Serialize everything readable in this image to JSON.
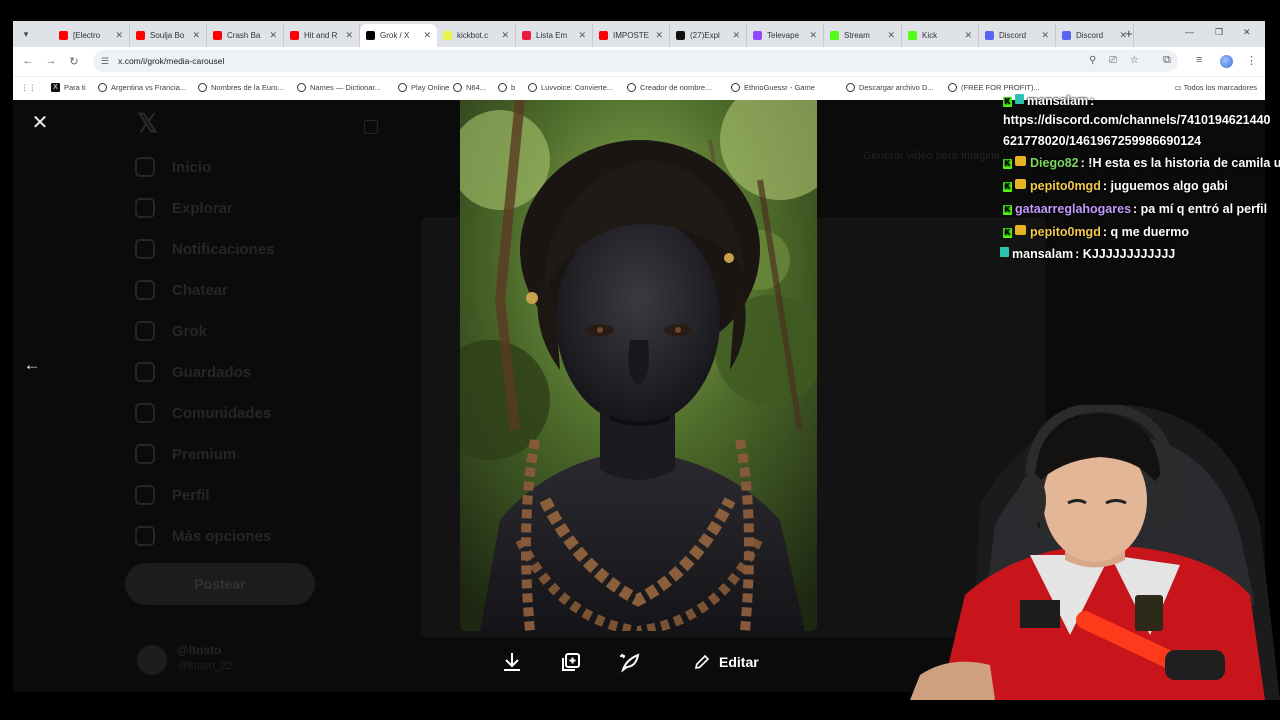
{
  "browser": {
    "tabs": [
      {
        "title": "[Electro",
        "color": "#ff0000"
      },
      {
        "title": "Soulja Bo",
        "color": "#ff0000"
      },
      {
        "title": "Crash Ba",
        "color": "#ff0000"
      },
      {
        "title": "Hit and R",
        "color": "#ff0000"
      },
      {
        "title": "Grok / X",
        "color": "#000000",
        "active": true
      },
      {
        "title": "kickbot.c",
        "color": "#e6f54a"
      },
      {
        "title": "Lista Em",
        "color": "#ec1c3c"
      },
      {
        "title": "IMPOSTE",
        "color": "#ff0000"
      },
      {
        "title": "(27)Expl",
        "color": "#111111"
      },
      {
        "title": "Televape",
        "color": "#9146ff"
      },
      {
        "title": "Stream",
        "color": "#53fc18"
      },
      {
        "title": "Kick",
        "color": "#53fc18"
      },
      {
        "title": "Discord",
        "color": "#5865f2"
      },
      {
        "title": "Discord",
        "color": "#5865f2"
      }
    ],
    "url": "x.com/i/grok/media-carousel",
    "bookmarks": [
      "Para ti",
      "Argentina vs Francia...",
      "Nombres de la Euro...",
      "Names — Dictionar...",
      "Play Online",
      "N64...",
      "b",
      "Luvvoice: Convierte...",
      "Creador de nombre...",
      "EthnoGuessr - Game",
      "Descargar archivo D...",
      "(FREE FOR PROFIT)..."
    ],
    "all_bookmarks": "Todos los marcadores"
  },
  "xpage": {
    "nav": [
      "Inicio",
      "Explorar",
      "Notificaciones",
      "Chatear",
      "Grok",
      "Guardados",
      "Comunidades",
      "Premium",
      "Perfil",
      "Más opciones"
    ],
    "post_button": "Postear",
    "account_name": "@ltnsto",
    "account_handle": "@ltnsto_22",
    "grok_note": "Generar video pera Imagine"
  },
  "media_toolbar": {
    "edit_label": "Editar",
    "icons": [
      "download-icon",
      "copy-add-icon",
      "animate-icon",
      "pencil-icon"
    ]
  },
  "chat": {
    "messages": [
      {
        "user": "mansalam",
        "text": ":",
        "color": "#ffffff"
      },
      {
        "user": "",
        "text": "https://discord.com/channels/7410194621440",
        "color": "#ffffff"
      },
      {
        "user": "",
        "text": "621778020/1461967259986690124",
        "color": "#ffffff"
      },
      {
        "user": "Diego82",
        "text": ": !H esta es la historia de camila u",
        "color": "#7dd660"
      },
      {
        "user": "pepito0mgd",
        "text": ": juguemos algo gabi",
        "color": "#f2c94c"
      },
      {
        "user": "gataarreglahogares",
        "text": ": pa mí q entró al perfil",
        "color": "#c39bff"
      },
      {
        "user": "pepito0mgd",
        "text": ": q me duermo",
        "color": "#f2c94c"
      },
      {
        "user": "mansalam",
        "text": ": KJJJJJJJJJJJJ",
        "color": "#ffffff"
      }
    ]
  }
}
